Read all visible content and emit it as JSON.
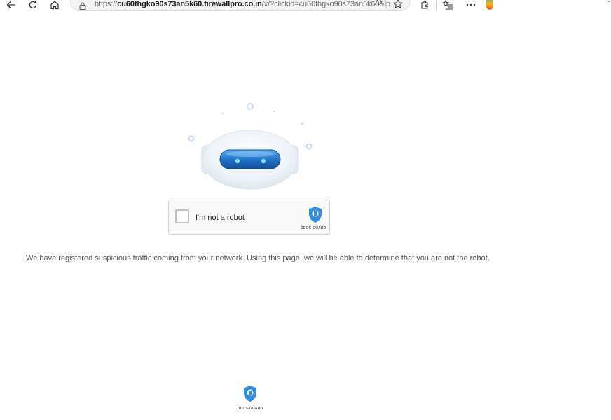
{
  "browser": {
    "url_prefix": "https://",
    "url_domain": "cu60fhgko90s73an5k60.firewallpro.co.in",
    "url_rest": "/x/?clickid=cu60fhgko90s73an5k60&lp...",
    "read_aloud": "Aᵃ"
  },
  "captcha": {
    "checkbox_label": "I'm not a robot",
    "brand": "DDOS-GUARD"
  },
  "message": "We have registered suspicious traffic coming from your network. Using this page, we will be able to determine that you are not the robot.",
  "footer": {
    "brand": "DDOS-GUARD"
  },
  "colors": {
    "shield_blue": "#2f8de4",
    "robot_visor": "#1f6fc7"
  },
  "icons": [
    "back-icon",
    "refresh-icon",
    "home-icon",
    "lock-icon",
    "read-aloud-icon",
    "favorite-star-icon",
    "extensions-icon",
    "favorites-list-icon",
    "more-icon",
    "copilot-icon",
    "shield-icon"
  ]
}
